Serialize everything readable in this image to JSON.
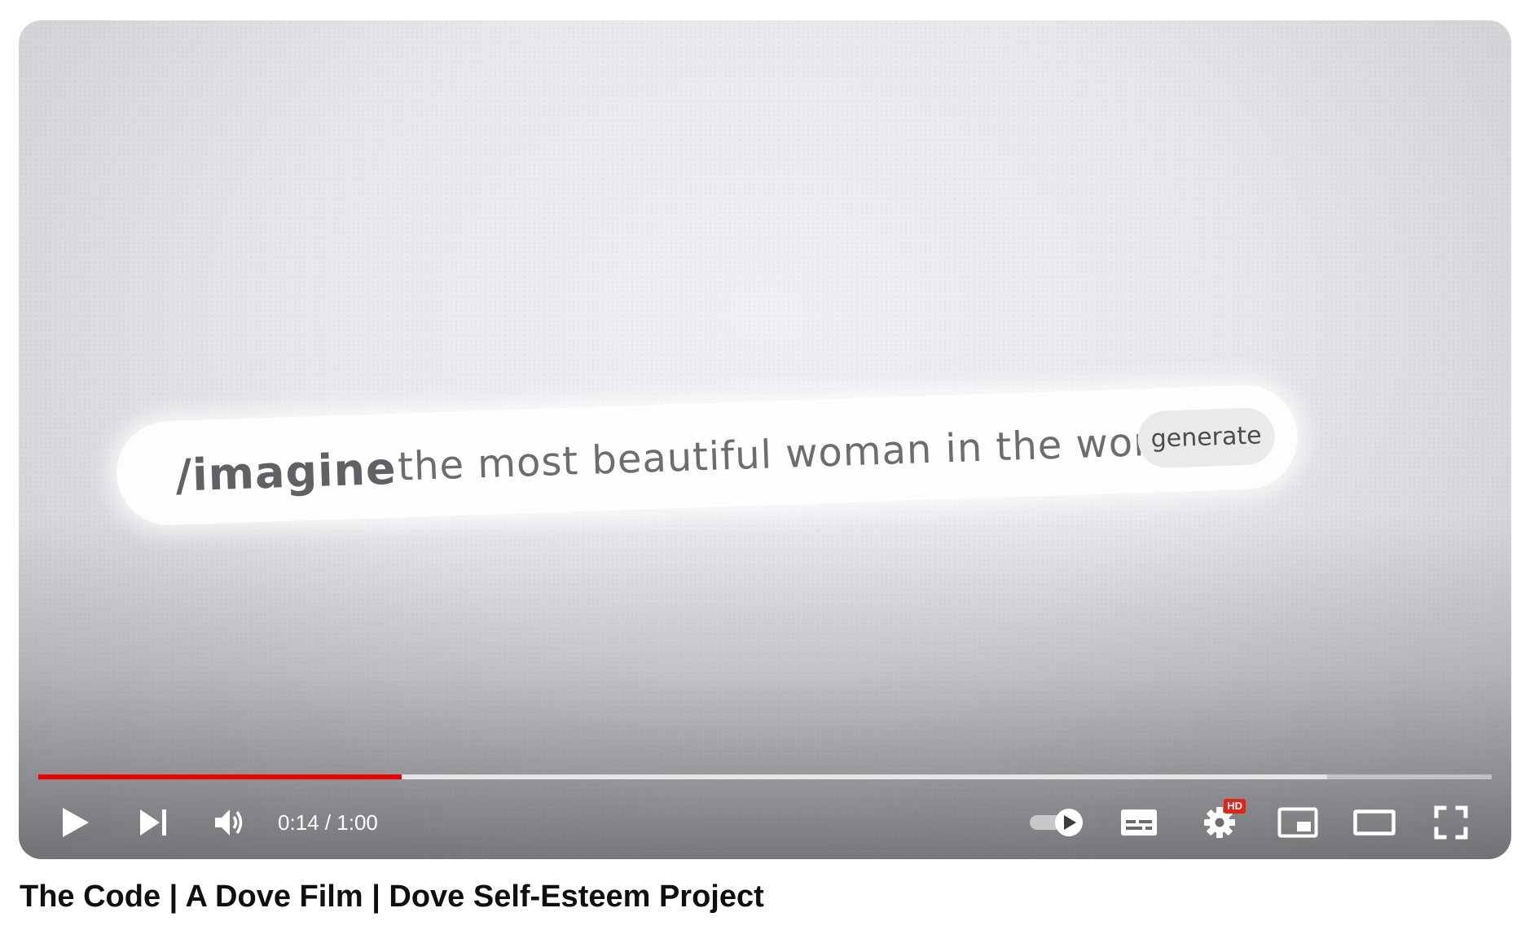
{
  "video": {
    "prompt_command": "/imagine",
    "prompt_text": "the most beautiful woman in the world",
    "generate_label": "generate"
  },
  "player": {
    "current_time": "0:14",
    "duration": "1:00",
    "time_display": "0:14 / 1:00",
    "played_fraction": 0.25,
    "loaded_fraction": 0.887,
    "hd_badge": "HD",
    "progress_color": "#f00000",
    "icons": [
      "play-icon",
      "next-icon",
      "volume-icon",
      "autoplay-toggle-icon",
      "subtitles-icon",
      "settings-icon",
      "miniplayer-icon",
      "theater-mode-icon",
      "fullscreen-icon"
    ]
  },
  "title": "The Code | A Dove Film | Dove Self-Esteem Project"
}
